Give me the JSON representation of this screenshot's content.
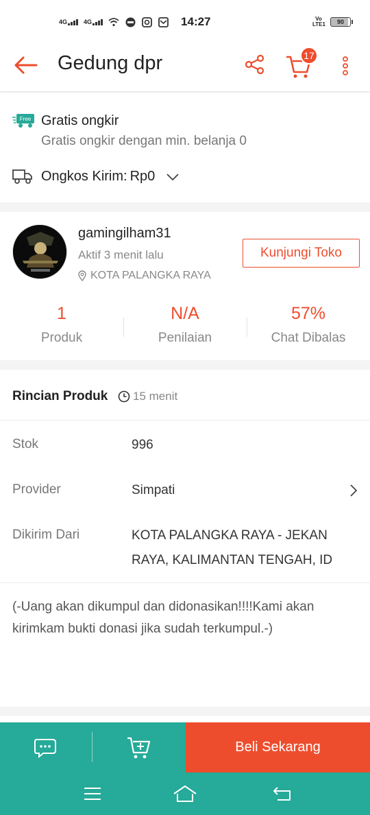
{
  "status_bar": {
    "signal1": "4G",
    "signal2": "4G",
    "time": "14:27",
    "volte": "Vo LTE1",
    "battery": "90"
  },
  "app_bar": {
    "title": "Gedung dpr",
    "cart_count": "17"
  },
  "shipping": {
    "free_badge": "Free",
    "title": "Gratis ongkir",
    "subtitle": "Gratis ongkir dengan min. belanja 0",
    "cost_label": "Ongkos Kirim:",
    "cost_value": "Rp0"
  },
  "shop": {
    "name": "gamingilham31",
    "active": "Aktif 3 menit lalu",
    "location": "KOTA PALANGKA RAYA",
    "visit_label": "Kunjungi Toko",
    "stats": [
      {
        "value": "1",
        "label": "Produk"
      },
      {
        "value": "N/A",
        "label": "Penilaian"
      },
      {
        "value": "57%",
        "label": "Chat Dibalas"
      }
    ]
  },
  "details": {
    "title": "Rincian Produk",
    "time": "15 menit",
    "rows": [
      {
        "label": "Stok",
        "value": "996"
      },
      {
        "label": "Provider",
        "value": "Simpati"
      },
      {
        "label": "Dikirim Dari",
        "value": "KOTA PALANGKA RAYA - JEKAN RAYA, KALIMANTAN TENGAH, ID"
      }
    ],
    "description": "(-Uang akan dikumpul dan didonasikan!!!!Kami akan kirimkam bukti donasi jika sudah terkumpul.-)"
  },
  "bottom_bar": {
    "buy_label": "Beli Sekarang"
  },
  "colors": {
    "accent": "#ee4d2d",
    "teal": "#26aa99"
  }
}
